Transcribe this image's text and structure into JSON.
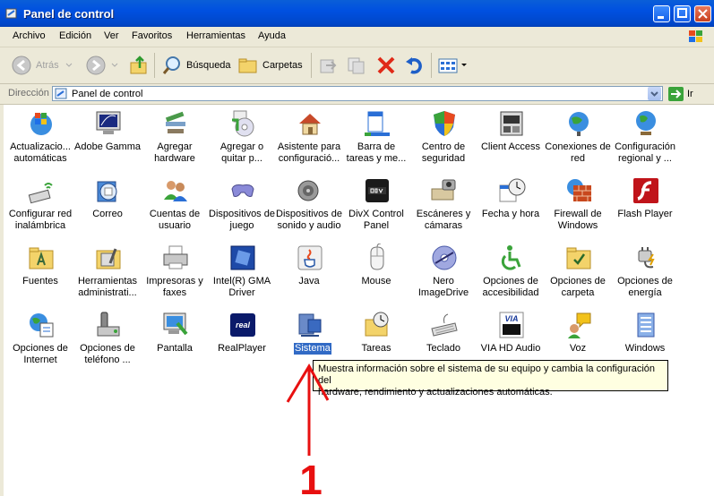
{
  "window": {
    "title": "Panel de control"
  },
  "menu": {
    "items": [
      "Archivo",
      "Edición",
      "Ver",
      "Favoritos",
      "Herramientas",
      "Ayuda"
    ]
  },
  "toolbar": {
    "back_label": "Atrás",
    "search_label": "Búsqueda",
    "folders_label": "Carpetas"
  },
  "address": {
    "label": "Dirección",
    "value": "Panel de control",
    "go_label": "Ir"
  },
  "items": [
    {
      "name": "Actualizacio... automáticas",
      "l1": "Actualizacio...",
      "l2": "automáticas"
    },
    {
      "name": "Adobe Gamma",
      "l1": "Adobe Gamma",
      "l2": ""
    },
    {
      "name": "Agregar hardware",
      "l1": "Agregar",
      "l2": "hardware"
    },
    {
      "name": "Agregar o quitar p...",
      "l1": "Agregar o",
      "l2": "quitar p..."
    },
    {
      "name": "Asistente para configuració...",
      "l1": "Asistente para",
      "l2": "configuració..."
    },
    {
      "name": "Barra de tareas y me...",
      "l1": "Barra de",
      "l2": "tareas y me..."
    },
    {
      "name": "Centro de seguridad",
      "l1": "Centro de",
      "l2": "seguridad"
    },
    {
      "name": "Client Access",
      "l1": "Client Access",
      "l2": ""
    },
    {
      "name": "Conexiones de red",
      "l1": "Conexiones de",
      "l2": "red"
    },
    {
      "name": "Configuración regional y ...",
      "l1": "Configuración",
      "l2": "regional y ..."
    },
    {
      "name": "Configurar red inalámbrica",
      "l1": "Configurar red",
      "l2": "inalámbrica"
    },
    {
      "name": "Correo",
      "l1": "Correo",
      "l2": ""
    },
    {
      "name": "Cuentas de usuario",
      "l1": "Cuentas de",
      "l2": "usuario"
    },
    {
      "name": "Dispositivos de juego",
      "l1": "Dispositivos de",
      "l2": "juego"
    },
    {
      "name": "Dispositivos de sonido y audio",
      "l1": "Dispositivos de",
      "l2": "sonido y audio"
    },
    {
      "name": "DivX Control Panel",
      "l1": "DivX Control",
      "l2": "Panel"
    },
    {
      "name": "Escáneres y cámaras",
      "l1": "Escáneres y",
      "l2": "cámaras"
    },
    {
      "name": "Fecha y hora",
      "l1": "Fecha y hora",
      "l2": ""
    },
    {
      "name": "Firewall de Windows",
      "l1": "Firewall de",
      "l2": "Windows"
    },
    {
      "name": "Flash Player",
      "l1": "Flash Player",
      "l2": ""
    },
    {
      "name": "Fuentes",
      "l1": "Fuentes",
      "l2": ""
    },
    {
      "name": "Herramientas administrati...",
      "l1": "Herramientas",
      "l2": "administrati..."
    },
    {
      "name": "Impresoras y faxes",
      "l1": "Impresoras y",
      "l2": "faxes"
    },
    {
      "name": "Intel(R) GMA Driver",
      "l1": "Intel(R) GMA",
      "l2": "Driver"
    },
    {
      "name": "Java",
      "l1": "Java",
      "l2": ""
    },
    {
      "name": "Mouse",
      "l1": "Mouse",
      "l2": ""
    },
    {
      "name": "Nero ImageDrive",
      "l1": "Nero",
      "l2": "ImageDrive"
    },
    {
      "name": "Opciones de accesibilidad",
      "l1": "Opciones de",
      "l2": "accesibilidad"
    },
    {
      "name": "Opciones de carpeta",
      "l1": "Opciones de",
      "l2": "carpeta"
    },
    {
      "name": "Opciones de energía",
      "l1": "Opciones de",
      "l2": "energía"
    },
    {
      "name": "Opciones de Internet",
      "l1": "Opciones de",
      "l2": "Internet"
    },
    {
      "name": "Opciones de teléfono ...",
      "l1": "Opciones de",
      "l2": "teléfono ..."
    },
    {
      "name": "Pantalla",
      "l1": "Pantalla",
      "l2": ""
    },
    {
      "name": "RealPlayer",
      "l1": "RealPlayer",
      "l2": ""
    },
    {
      "name": "Sistema",
      "l1": "Sistema",
      "l2": "",
      "selected": true
    },
    {
      "name": "Tareas",
      "l1": "Tareas",
      "l2": ""
    },
    {
      "name": "Teclado",
      "l1": "Teclado",
      "l2": ""
    },
    {
      "name": "VIA HD Audio",
      "l1": "VIA HD Audio",
      "l2": ""
    },
    {
      "name": "Voz",
      "l1": "Voz",
      "l2": ""
    },
    {
      "name": "Windows",
      "l1": "Windows",
      "l2": ""
    }
  ],
  "tooltip": {
    "line1": "Muestra información sobre el sistema de su equipo y cambia la configuración del",
    "line2": "hardware, rendimiento y actualizaciones automáticas."
  },
  "annotation": {
    "number": "1"
  }
}
